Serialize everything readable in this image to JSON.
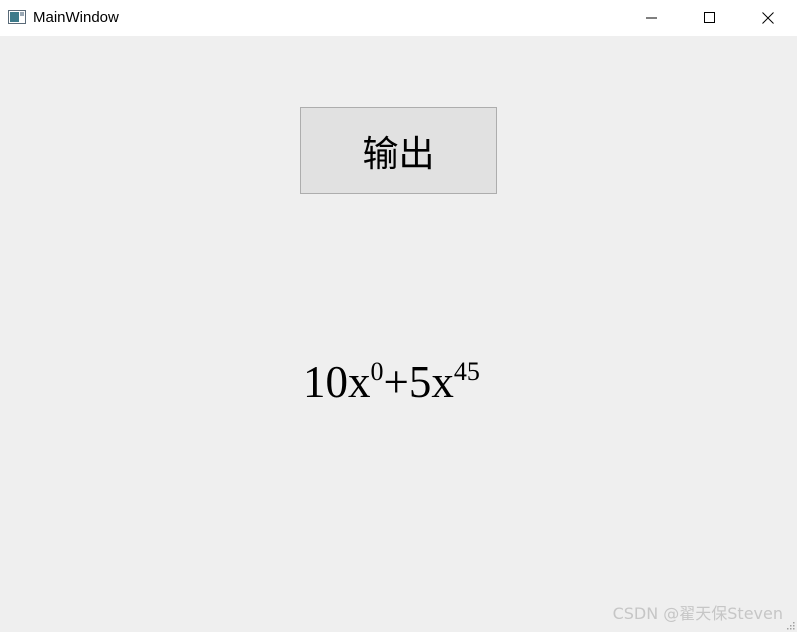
{
  "window": {
    "title": "MainWindow",
    "controls": {
      "minimize_icon": "minimize-icon",
      "maximize_icon": "maximize-icon",
      "close_icon": "close-icon"
    }
  },
  "main": {
    "output_button_label": "输出",
    "polynomial": {
      "terms": [
        {
          "coef": "10x",
          "exp": "0"
        },
        {
          "sep": "+"
        },
        {
          "coef": "5x",
          "exp": "45"
        }
      ],
      "term1_coef": "10x",
      "term1_exp": "0",
      "plus": "+",
      "term2_coef": "5x",
      "term2_exp": "45"
    }
  },
  "watermark": "CSDN @翟天保Steven",
  "colors": {
    "titlebar_bg": "#ffffff",
    "client_bg": "#efefef",
    "button_bg": "#e1e1e1",
    "button_border": "#adadad"
  }
}
